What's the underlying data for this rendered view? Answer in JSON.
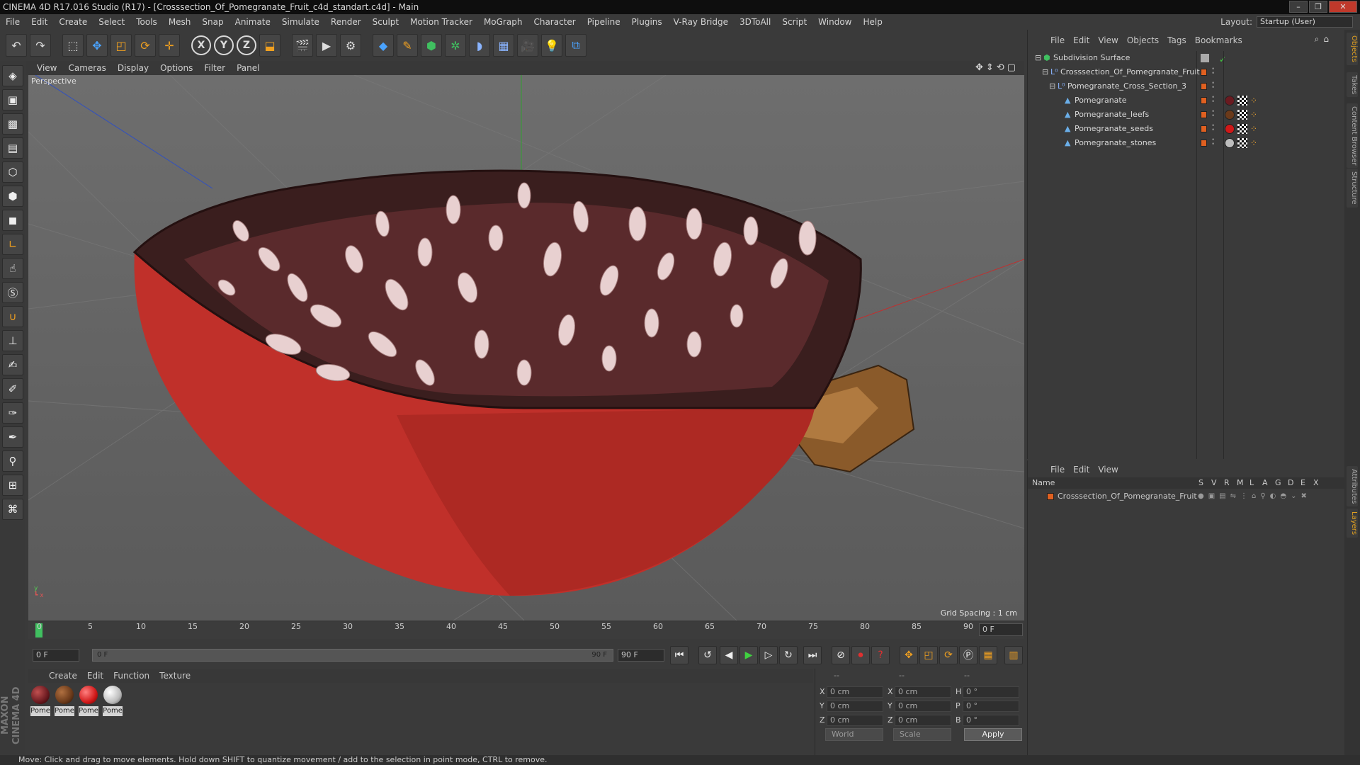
{
  "title": "CINEMA 4D R17.016 Studio (R17) - [Crosssection_Of_Pomegranate_Fruit_c4d_standart.c4d] - Main",
  "menu": [
    "File",
    "Edit",
    "Create",
    "Select",
    "Tools",
    "Mesh",
    "Snap",
    "Animate",
    "Simulate",
    "Render",
    "Sculpt",
    "Motion Tracker",
    "MoGraph",
    "Character",
    "Pipeline",
    "Plugins",
    "V-Ray Bridge",
    "3DToAll",
    "Script",
    "Window",
    "Help"
  ],
  "layout": {
    "label": "Layout:",
    "value": "Startup (User)"
  },
  "toolbar": {
    "axis_x": "X",
    "axis_y": "Y",
    "axis_z": "Z"
  },
  "viewport": {
    "menu": [
      "View",
      "Cameras",
      "Display",
      "Options",
      "Filter",
      "Panel"
    ],
    "label": "Perspective",
    "grid_spacing": "Grid Spacing : 1 cm"
  },
  "timeline": {
    "ticks": [
      "0",
      "5",
      "10",
      "15",
      "20",
      "25",
      "30",
      "35",
      "40",
      "45",
      "50",
      "55",
      "60",
      "65",
      "70",
      "75",
      "80",
      "85",
      "90"
    ],
    "current_frame": "0 F"
  },
  "transport": {
    "start_field": "0 F",
    "range_start": "0 F",
    "range_end": "90 F",
    "end_field": "90 F"
  },
  "materials": {
    "menu": [
      "Create",
      "Edit",
      "Function",
      "Texture"
    ],
    "items": [
      {
        "label": "Pome",
        "color": "#6a1a20"
      },
      {
        "label": "Pome",
        "color": "#6b3a1a"
      },
      {
        "label": "Pome",
        "color": "#d01818"
      },
      {
        "label": "Pome",
        "color": "#bdbdbd"
      }
    ]
  },
  "coords": {
    "headers": [
      "--",
      "--",
      "--"
    ],
    "rows": [
      {
        "a": "X",
        "av": "0 cm",
        "b": "X",
        "bv": "0 cm",
        "c": "H",
        "cv": "0 °"
      },
      {
        "a": "Y",
        "av": "0 cm",
        "b": "Y",
        "bv": "0 cm",
        "c": "P",
        "cv": "0 °"
      },
      {
        "a": "Z",
        "av": "0 cm",
        "b": "Z",
        "bv": "0 cm",
        "c": "B",
        "cv": "0 °"
      }
    ],
    "world": "World",
    "scale": "Scale",
    "apply": "Apply"
  },
  "objects": {
    "menu": [
      "File",
      "Edit",
      "View",
      "Objects",
      "Tags",
      "Bookmarks"
    ],
    "items": [
      {
        "name": "Subdivision Surface"
      },
      {
        "name": "Crosssection_Of_Pomegranate_Fruit"
      },
      {
        "name": "Pomegranate_Cross_Section_3"
      },
      {
        "name": "Pomegranate",
        "tag_color": "#6a1a20"
      },
      {
        "name": "Pomegranate_leefs",
        "tag_color": "#6b3a1a"
      },
      {
        "name": "Pomegranate_seeds",
        "tag_color": "#d01818"
      },
      {
        "name": "Pomegranate_stones",
        "tag_color": "#bdbdbd"
      }
    ]
  },
  "layers": {
    "menu": [
      "File",
      "Edit",
      "View"
    ],
    "columns": [
      "Name",
      "S",
      "V",
      "R",
      "M",
      "L",
      "A",
      "G",
      "D",
      "E",
      "X"
    ],
    "row": "Crosssection_Of_Pomegranate_Fruit"
  },
  "right_tabs": [
    "Objects",
    "Takes",
    "Content Browser",
    "Structure",
    "Attributes",
    "Layers"
  ],
  "status": "Move: Click and drag to move elements. Hold down SHIFT to quantize movement / add to the selection in point mode, CTRL to remove."
}
